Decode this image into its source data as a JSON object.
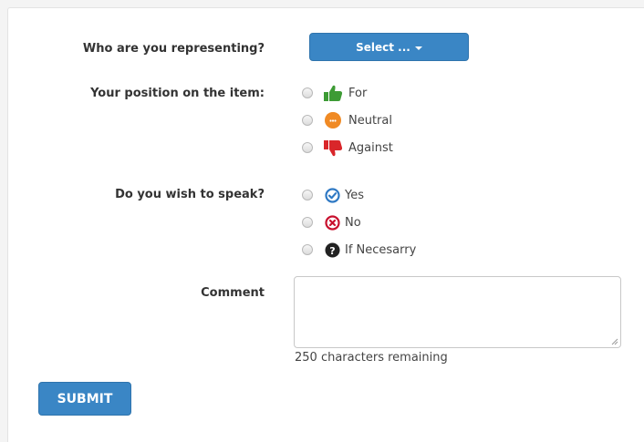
{
  "form": {
    "representing": {
      "label": "Who are you representing?",
      "select_text": "Select ..."
    },
    "position": {
      "label": "Your position on the item:",
      "options": [
        {
          "label": "For",
          "icon": "thumbs-up-icon",
          "color": "#3d9b35"
        },
        {
          "label": "Neutral",
          "icon": "neutral-face-icon",
          "color": "#f08a24"
        },
        {
          "label": "Against",
          "icon": "thumbs-down-icon",
          "color": "#d9262a"
        }
      ]
    },
    "speak": {
      "label": "Do you wish to speak?",
      "options": [
        {
          "label": "Yes",
          "icon": "check-circle-icon",
          "color": "#2f79c4"
        },
        {
          "label": "No",
          "icon": "x-circle-icon",
          "color": "#c8102e"
        },
        {
          "label": "If Necesarry",
          "icon": "question-circle-icon",
          "color": "#222222"
        }
      ]
    },
    "comment": {
      "label": "Comment",
      "value": "",
      "remaining": "250 characters remaining"
    },
    "submit_label": "SUBMIT"
  },
  "colors": {
    "button": "#3a86c5",
    "label_text": "#333333"
  }
}
